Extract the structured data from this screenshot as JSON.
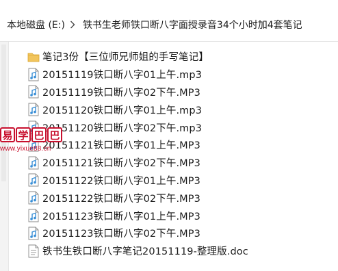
{
  "breadcrumb": {
    "drive": "本地磁盘 (E:)",
    "separator_icon": "chevron-right-icon",
    "folder": "铁书生老师铁口断八字面授录音34个小时加4套笔记"
  },
  "files": [
    {
      "name": "笔记3份【三位师兄师姐的手写笔记】",
      "type": "folder",
      "icon": "folder-icon"
    },
    {
      "name": "20151119铁口断八字01上午.mp3",
      "type": "audio",
      "icon": "audio-file-icon"
    },
    {
      "name": "20151119铁口断八字02下午.MP3",
      "type": "audio",
      "icon": "audio-file-icon"
    },
    {
      "name": "20151120铁口断八字01上午.mp3",
      "type": "audio",
      "icon": "audio-file-icon"
    },
    {
      "name": "20151120铁口断八字02下午.mp3",
      "type": "audio",
      "icon": "audio-file-icon"
    },
    {
      "name": "20151121铁口断八字01上午.MP3",
      "type": "audio",
      "icon": "audio-file-icon"
    },
    {
      "name": "20151121铁口断八字02下午.MP3",
      "type": "audio",
      "icon": "audio-file-icon"
    },
    {
      "name": "20151122铁口断八字01上午.MP3",
      "type": "audio",
      "icon": "audio-file-icon"
    },
    {
      "name": "20151122铁口断八字02下午.MP3",
      "type": "audio",
      "icon": "audio-file-icon"
    },
    {
      "name": "20151123铁口断八字01上午.MP3",
      "type": "audio",
      "icon": "audio-file-icon"
    },
    {
      "name": "20151123铁口断八字02下午.MP3",
      "type": "audio",
      "icon": "audio-file-icon"
    },
    {
      "name": "铁书生铁口断八字笔记20151119-整理版.doc",
      "type": "document",
      "icon": "document-file-icon"
    }
  ],
  "watermark": {
    "characters": [
      "易",
      "学",
      "巴",
      "巴"
    ],
    "url": "www.yixue88.cn",
    "color": "#c8102e"
  },
  "colors": {
    "folder": "#f2c55c",
    "audio_icon": "#3a8fd6",
    "text": "#1a1a1a"
  }
}
